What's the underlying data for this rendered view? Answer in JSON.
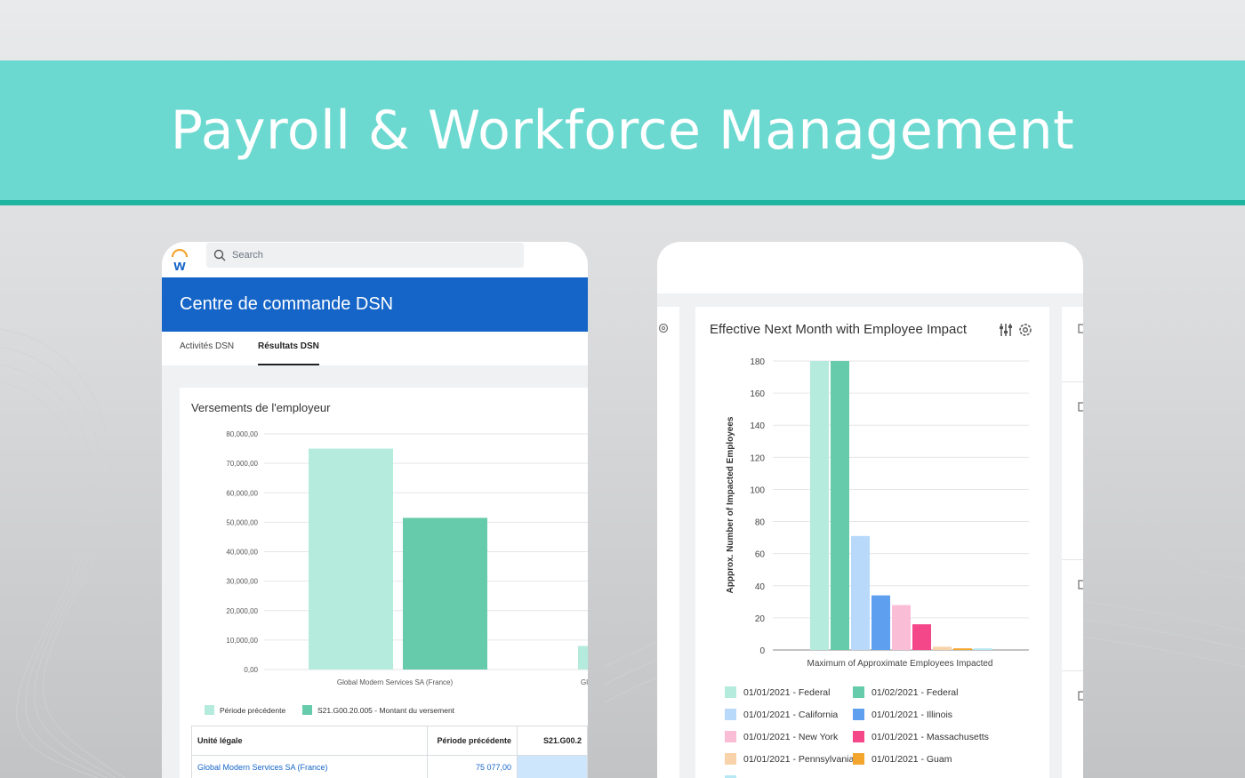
{
  "banner": {
    "title": "Payroll & Workforce Management"
  },
  "left_card": {
    "search_placeholder": "Search",
    "header": "Centre de commande DSN",
    "tabs": [
      {
        "label": "Activités DSN",
        "active": false
      },
      {
        "label": "Résultats DSN",
        "active": true
      }
    ],
    "panel_title": "Versements de l'employeur",
    "table": {
      "headers": [
        "Unité légale",
        "Période précédente",
        "S21.G00.2"
      ],
      "rows": [
        {
          "unit": "Global Modern Services SA (France)",
          "previous": "75 077,00",
          "current": ""
        }
      ]
    }
  },
  "right_card": {
    "panel_title": "Effective Next Month with Employee Impact"
  },
  "chart_data": [
    {
      "type": "bar",
      "title": "Versements de l'employeur",
      "categories": [
        "Global Modern Services SA (France)",
        "Gl"
      ],
      "series": [
        {
          "name": "Période précédente",
          "color": "#b4ebdc",
          "values": [
            75000,
            8000
          ]
        },
        {
          "name": "S21.G00.20.005 - Montant du versement",
          "color": "#66cbab",
          "values": [
            51500,
            null
          ]
        }
      ],
      "ylim": [
        0,
        80000
      ],
      "yticks": [
        "0,00",
        "10,000,00",
        "20,000,00",
        "30,000,00",
        "40,000,00",
        "50,000,00",
        "60,000,00",
        "70,000,00",
        "80,000,00"
      ],
      "legend": "bottom"
    },
    {
      "type": "bar",
      "title": "Effective Next Month with Employee Impact",
      "xlabel": "Maximum of Approximate Employees Impacted",
      "ylabel": "Appprox. Number of Impacted Employees",
      "ylim": [
        0,
        180
      ],
      "yticks": [
        0,
        20,
        40,
        60,
        80,
        100,
        120,
        140,
        160,
        180
      ],
      "series": [
        {
          "name": "01/01/2021 - Federal",
          "color": "#b4ebdc",
          "value": 180
        },
        {
          "name": "01/02/2021 - Federal",
          "color": "#66cbab",
          "value": 180
        },
        {
          "name": "01/01/2021 - California",
          "color": "#b9d9fb",
          "value": 71
        },
        {
          "name": "01/01/2021 - Illinois",
          "color": "#5f9ff0",
          "value": 34
        },
        {
          "name": "01/01/2021 - New York",
          "color": "#f9bed6",
          "value": 28
        },
        {
          "name": "01/01/2021 - Massachusetts",
          "color": "#f3478a",
          "value": 16
        },
        {
          "name": "01/01/2021 - Pennsylvania",
          "color": "#f8d2a8",
          "value": 2
        },
        {
          "name": "01/01/2021 - Guam",
          "color": "#f3a52d",
          "value": 1
        },
        {
          "name": "",
          "color": "#b7e8f3",
          "value": 1
        }
      ],
      "legend": "bottom"
    }
  ]
}
